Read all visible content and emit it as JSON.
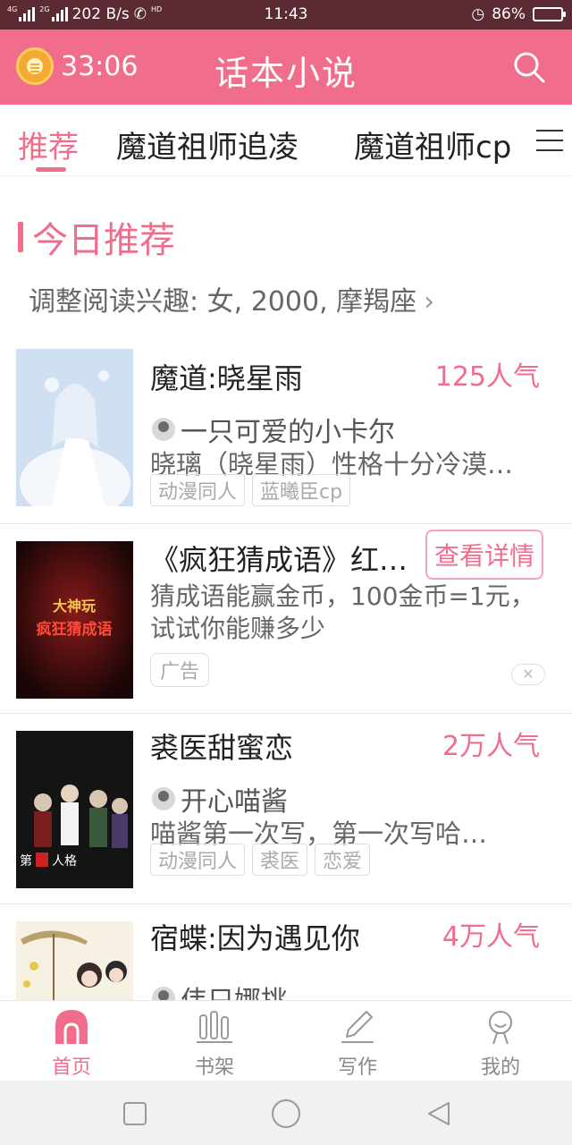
{
  "status_bar": {
    "network_left": "4G",
    "network_right": "2G",
    "speed": "202 B/s",
    "call_tag": "HD",
    "time": "11:43",
    "battery": "86%",
    "battery_level": 0.86
  },
  "header": {
    "timer": "33:06",
    "title": "话本小说"
  },
  "tabs": [
    {
      "label": "推荐"
    },
    {
      "label": "魔道祖师追凌"
    },
    {
      "label": "魔道祖师cp"
    }
  ],
  "section": {
    "title": "今日推荐",
    "preferences": "调整阅读兴趣: 女, 2000, 摩羯座"
  },
  "books": [
    {
      "title": "魔道:晓星雨",
      "popularity": "125人气",
      "author": "一只可爱的小卡尔",
      "desc": "晓璃（晓星雨）性格十分冷漠…",
      "tags": [
        "动漫同人",
        "蓝曦臣cp"
      ]
    },
    {
      "title": "裘医甜蜜恋",
      "popularity": "2万人气",
      "author": "开心喵酱",
      "desc": "喵酱第一次写，第一次写哈…",
      "tags": [
        "动漫同人",
        "裘医",
        "恋爱"
      ]
    },
    {
      "title": "宿蝶:因为遇见你",
      "popularity": "4万人气",
      "author": "伟只娜挑"
    }
  ],
  "ad": {
    "cover_line1": "大神玩",
    "cover_line2": "疯狂猜成语",
    "title": "《疯狂猜成语》红…",
    "button": "查看详情",
    "desc": "猜成语能赢金币，100金币=1元，试试你能赚多少",
    "tag": "广告",
    "close": "✕"
  },
  "bottom_nav": [
    {
      "label": "首页"
    },
    {
      "label": "书架"
    },
    {
      "label": "写作"
    },
    {
      "label": "我的"
    }
  ],
  "colors": {
    "accent": "#f06d8c",
    "status_bar": "#5b2a33"
  }
}
